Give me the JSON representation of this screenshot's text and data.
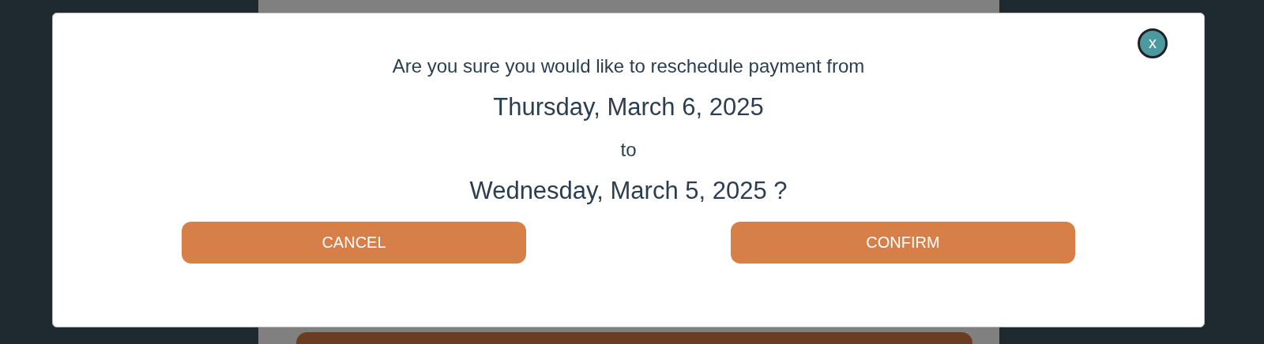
{
  "dialog": {
    "question": "Are you sure you would like to reschedule payment from",
    "from_date": "Thursday, March 6, 2025",
    "connector": "to",
    "to_date": "Wednesday, March 5, 2025 ?",
    "close": "x",
    "buttons": [
      {
        "label": "CANCEL"
      },
      {
        "label": "CONFIRM"
      }
    ]
  }
}
